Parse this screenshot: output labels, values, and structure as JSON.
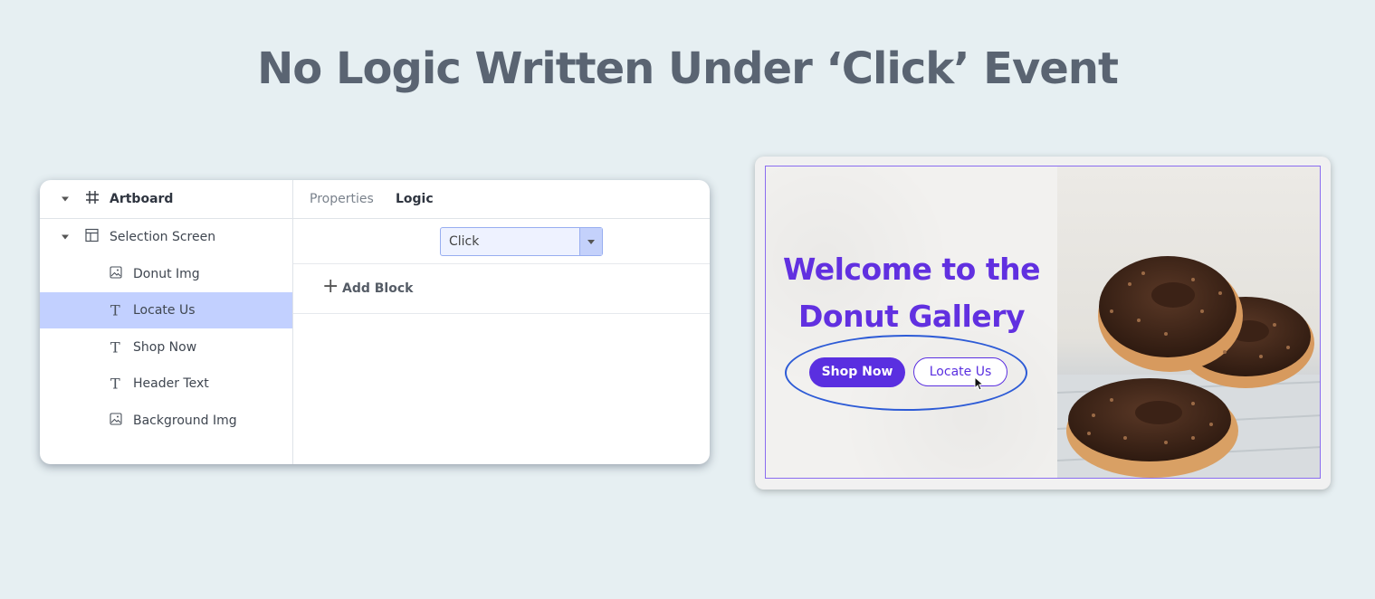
{
  "headline": "No Logic Written Under ‘Click’ Event",
  "editor": {
    "layers": {
      "artboard": "Artboard",
      "selection_screen": "Selection Screen",
      "items": [
        {
          "label": "Donut Img",
          "type": "image"
        },
        {
          "label": "Locate Us",
          "type": "text",
          "selected": true
        },
        {
          "label": "Shop Now",
          "type": "text"
        },
        {
          "label": "Header Text",
          "type": "text"
        },
        {
          "label": "Background Img",
          "type": "image"
        }
      ]
    },
    "tabs": {
      "properties": "Properties",
      "logic": "Logic"
    },
    "event_select": {
      "value": "Click"
    },
    "add_block": "Add Block"
  },
  "preview": {
    "title_line1": "Welcome to the",
    "title_line2": "Donut Gallery",
    "shop_button": "Shop Now",
    "locate_button": "Locate Us"
  },
  "colors": {
    "background": "#e6eff2",
    "headline": "#5a6472",
    "accent_purple": "#5a2fe0",
    "selected_row": "#c2d0ff",
    "highlight_ellipse": "#2d5bd6"
  }
}
